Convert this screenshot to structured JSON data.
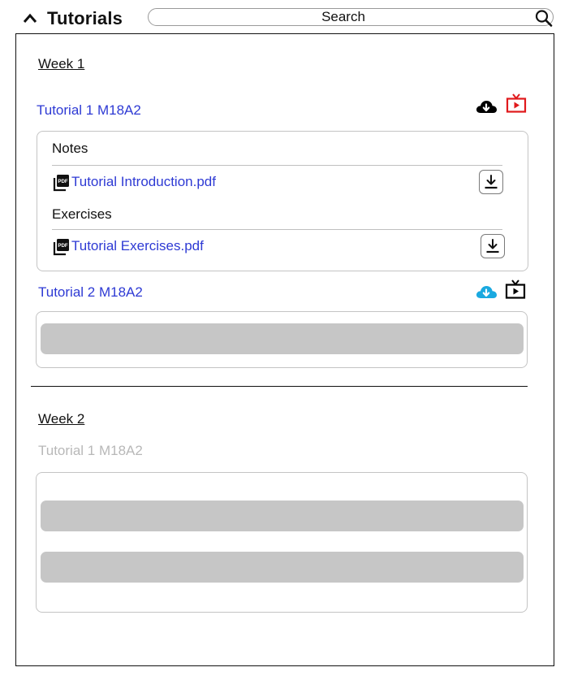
{
  "header": {
    "title": "Tutorials",
    "search_placeholder": "Search"
  },
  "weeks": [
    {
      "label": "Week 1",
      "tutorials": [
        {
          "title": "Tutorial 1 M18A2",
          "cloud_color": "#000000",
          "tv_color": "#e0191c",
          "sections": [
            {
              "label": "Notes",
              "file": "Tutorial Introduction.pdf"
            },
            {
              "label": "Exercises",
              "file": "Tutorial Exercises.pdf"
            }
          ]
        },
        {
          "title": "Tutorial 2 M18A2",
          "cloud_color": "#1aa9e0",
          "tv_color": "#000000"
        }
      ]
    },
    {
      "label": "Week 2",
      "tutorials": [
        {
          "title": "Tutorial 1 M18A2",
          "state": "disabled"
        }
      ]
    }
  ],
  "colors": {
    "link": "#2e3ad4",
    "disabled_text": "#b8b8b8",
    "placeholder_bar": "#c6c6c6"
  },
  "icons": [
    "chevron-up-icon",
    "search-icon",
    "cloud-download-icon",
    "tv-play-icon",
    "pdf-icon",
    "download-icon"
  ]
}
